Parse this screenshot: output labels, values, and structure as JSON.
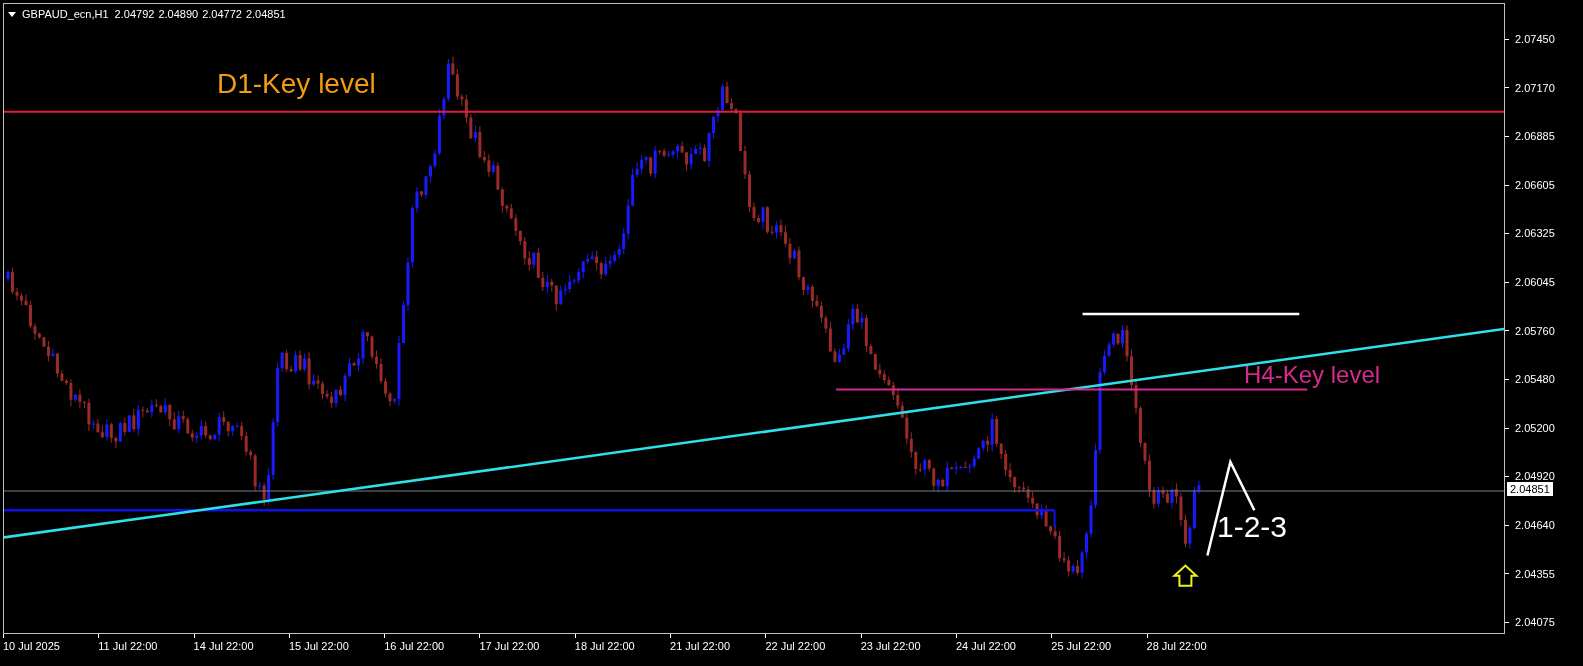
{
  "chart_header": {
    "symbol": "GBPAUD_ecn,H1",
    "ohlc": [
      "2.04792",
      "2.04890",
      "2.04772",
      "2.04851"
    ]
  },
  "annotations": [
    {
      "kind": "d1",
      "text": "D1-Key level",
      "color": "#f39c12"
    },
    {
      "kind": "h4",
      "text": "H4-Key level",
      "color": "#d62b8c"
    },
    {
      "kind": "pattern",
      "text": "1-2-3",
      "color": "#ffffff"
    }
  ],
  "price_axis": [
    "2.07450",
    "2.07170",
    "2.06885",
    "2.06605",
    "2.06325",
    "2.06045",
    "2.05760",
    "2.05480",
    "2.05200",
    "2.04920",
    "2.04640",
    "2.04355",
    "2.04075"
  ],
  "current_price": "2.04851",
  "time_axis": [
    "10 Jul 2025",
    "11 Jul 22:00",
    "14 Jul 22:00",
    "15 Jul 22:00",
    "16 Jul 22:00",
    "17 Jul 22:00",
    "18 Jul 22:00",
    "21 Jul 22:00",
    "22 Jul 22:00",
    "23 Jul 22:00",
    "24 Jul 22:00",
    "25 Jul 22:00",
    "28 Jul 22:00"
  ]
}
